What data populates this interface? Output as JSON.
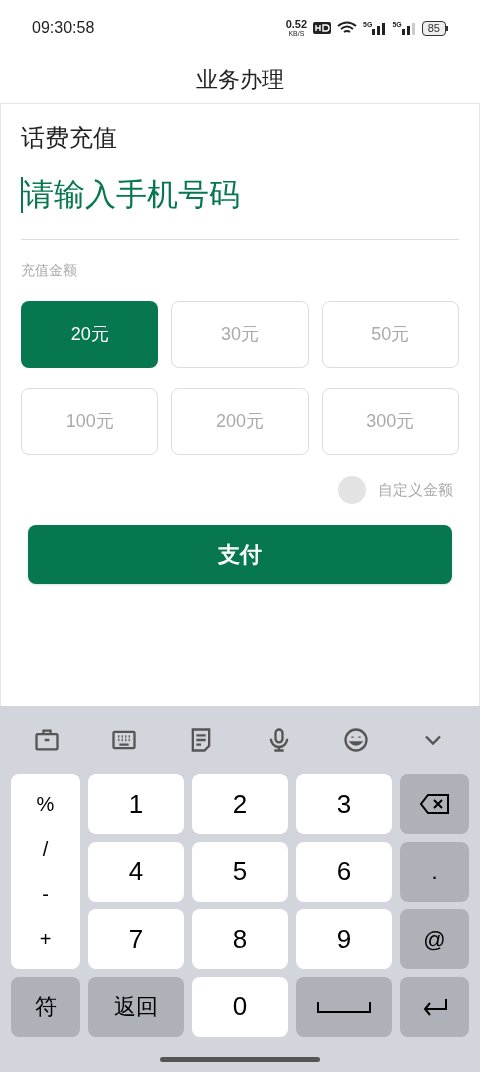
{
  "status_bar": {
    "time": "09:30:58",
    "speed": "0.52",
    "speed_unit": "KB/S",
    "network_labels": [
      "5G",
      "5G"
    ],
    "battery": "85"
  },
  "header": {
    "title": "业务办理"
  },
  "section_title": "话费充值",
  "phone_field": {
    "placeholder": "请输入手机号码",
    "focused": true
  },
  "amount_label": "充值金额",
  "amounts": [
    {
      "label": "20元",
      "selected": true
    },
    {
      "label": "30元",
      "selected": false
    },
    {
      "label": "50元",
      "selected": false
    },
    {
      "label": "100元",
      "selected": false
    },
    {
      "label": "200元",
      "selected": false
    },
    {
      "label": "300元",
      "selected": false
    }
  ],
  "custom_amount": {
    "label": "自定义金额",
    "checked": false
  },
  "pay_button": "支付",
  "keyboard": {
    "toolbar": [
      {
        "kind": "toolbox"
      },
      {
        "kind": "keyboard"
      },
      {
        "kind": "clipboard"
      },
      {
        "kind": "microphone"
      },
      {
        "kind": "emoji"
      },
      {
        "kind": "collapse"
      }
    ],
    "symbols": [
      "%",
      "/",
      "-",
      "+"
    ],
    "digits": [
      "1",
      "2",
      "3",
      "4",
      "5",
      "6",
      "7",
      "8",
      "9"
    ],
    "side_keys": [
      {
        "kind": "backspace"
      },
      {
        "kind": "text",
        "label": "."
      },
      {
        "kind": "text",
        "label": "@"
      }
    ],
    "bottom": [
      {
        "kind": "text",
        "label": "符"
      },
      {
        "kind": "text",
        "label": "返回"
      },
      {
        "kind": "digit",
        "label": "0"
      },
      {
        "kind": "space"
      },
      {
        "kind": "enter"
      }
    ]
  }
}
